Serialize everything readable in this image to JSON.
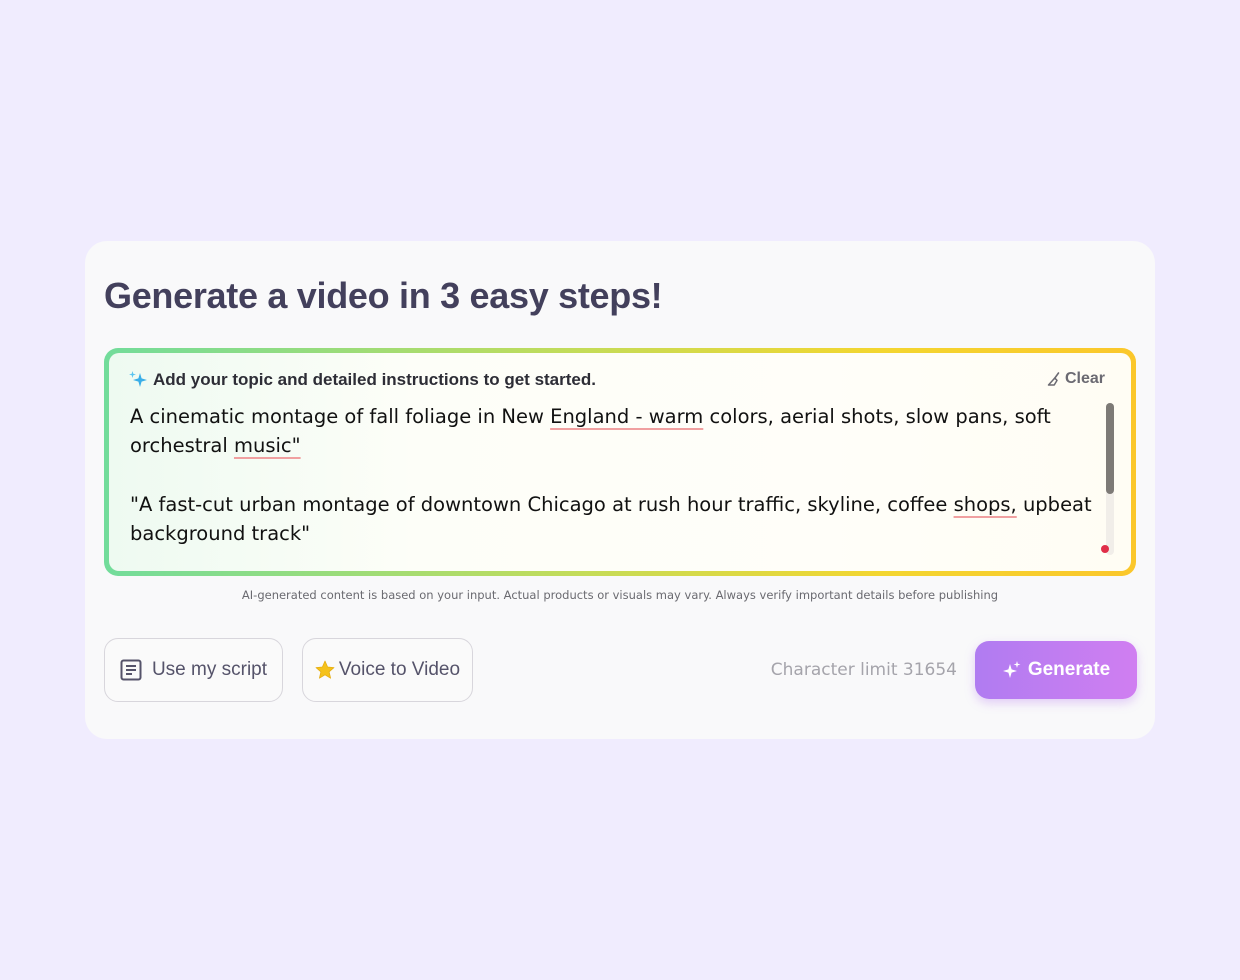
{
  "page": {
    "title": "Generate a video in 3 easy steps!"
  },
  "prompt": {
    "label": "Add your topic and detailed instructions to get started.",
    "clear_label": "Clear",
    "paragraphs": [
      {
        "before": "A cinematic montage of fall foliage in New ",
        "flagged": "England - warm",
        "after": " colors, aerial shots, slow pans, soft orchestral ",
        "flagged2": "music\"",
        "after2": ""
      },
      {
        "before": "\"A fast-cut urban montage of downtown Chicago at rush hour traffic, skyline, coffee ",
        "flagged": "shops,",
        "after": " upbeat background track\""
      }
    ],
    "scroll_fraction_visible": 0.6
  },
  "disclaimer": "AI-generated content is based on your input. Actual products or visuals may vary. Always verify important details before publishing",
  "actions": {
    "use_script_label": "Use my script",
    "voice_to_video_label": "Voice to Video",
    "character_limit": "Character limit 31654",
    "generate_label": "Generate"
  },
  "colors": {
    "background": "#f0ecfe",
    "title": "#43405c",
    "gradient_border_start": "#72dc9b",
    "gradient_border_end": "#fbc72b",
    "generate_start": "#b07cf1",
    "generate_end": "#d07ef1",
    "status_dot": "#e02e48",
    "sparkle_icon": "#3aaee8",
    "star_icon": "#f5c21b"
  },
  "icons": {
    "prompt": "sparkle-icon",
    "clear": "broom-icon",
    "script": "document-icon",
    "voice": "star-icon",
    "generate": "sparkle-icon"
  }
}
